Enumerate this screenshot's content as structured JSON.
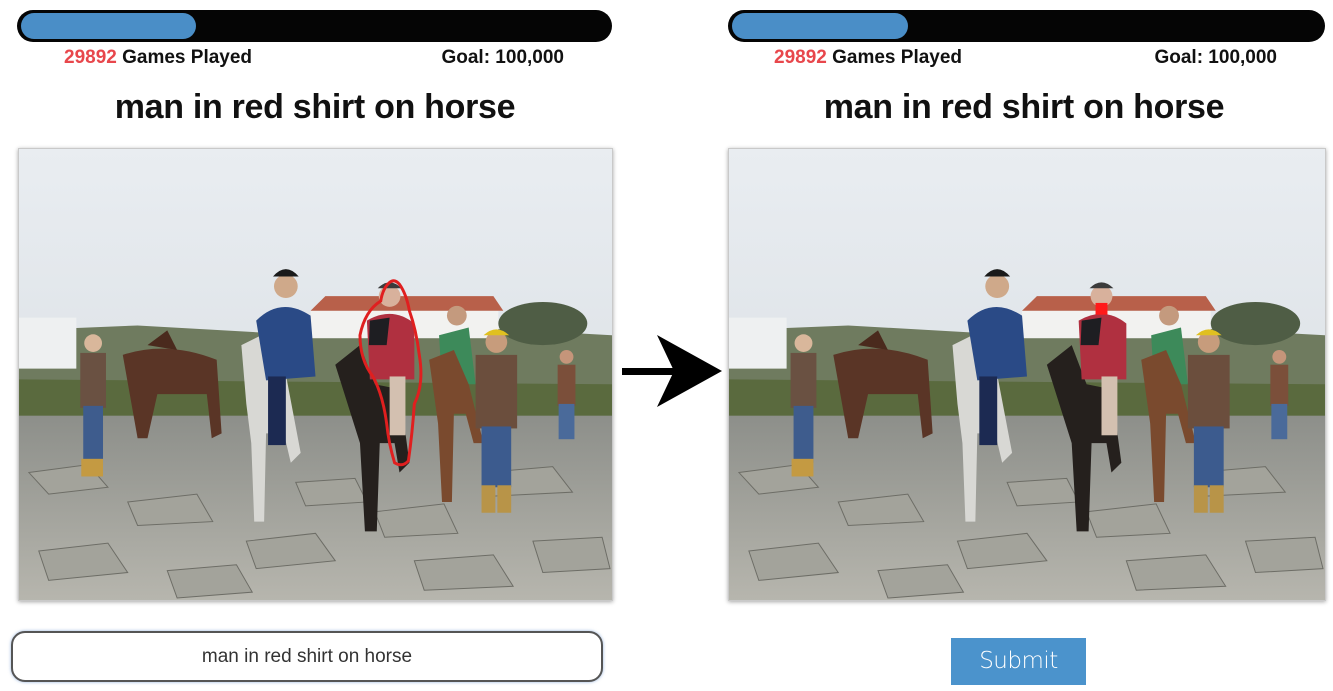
{
  "left": {
    "progress_fraction": 0.29892,
    "games_count": "29892",
    "games_label": " Games Played",
    "goal_label": "Goal: 100,000",
    "phrase": "man in red shirt on horse",
    "answer_input": "man in red shirt on horse"
  },
  "right": {
    "progress_fraction": 0.29892,
    "games_count": "29892",
    "games_label": " Games Played",
    "goal_label": "Goal: 100,000",
    "phrase": "man in red shirt on horse",
    "submit_label": "Submit"
  },
  "colors": {
    "progress_fill": "#4a8ec7",
    "count_text": "#e8474c",
    "segmentation_outline": "#e01f1f",
    "submit_button": "#4b93cc"
  },
  "icons": {
    "transition": "arrow-right-icon"
  }
}
